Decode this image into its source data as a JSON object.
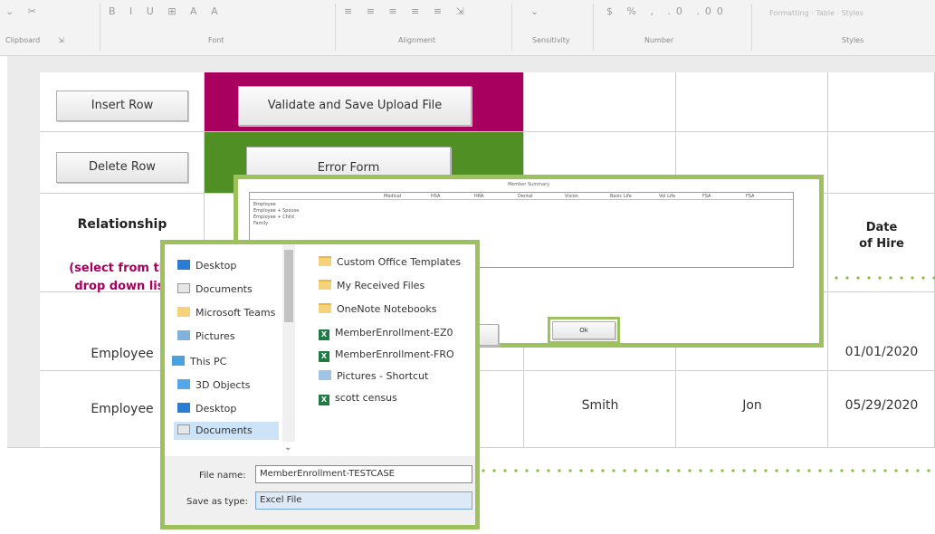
{
  "ribbon": {
    "groups": [
      "Clipboard",
      "Font",
      "Alignment",
      "Sensitivity",
      "Number",
      "Styles"
    ],
    "styles_items": [
      "Formatting",
      "Table",
      "Styles"
    ]
  },
  "sheet": {
    "buttons": {
      "insert_row": "Insert Row",
      "delete_row": "Delete Row",
      "validate_save": "Validate and Save Upload File",
      "error_form": "Error Form"
    },
    "headers": {
      "relationship": "Relationship",
      "relationship_hint_line1": "(select from the",
      "relationship_hint_line2": "drop down list",
      "date_of_hire_line1": "Date",
      "date_of_hire_line2": "of Hire"
    },
    "rows": [
      {
        "relationship": "Employee",
        "last": "",
        "first": "",
        "date": "01/01/2020"
      },
      {
        "relationship": "Employee",
        "last": "Smith",
        "first": "Jon",
        "date": "05/29/2020"
      }
    ]
  },
  "summary_dialog": {
    "title": "Member Summary",
    "columns": [
      "Medical",
      "HSA",
      "HRA",
      "Dental",
      "Vision",
      "Basic Life",
      "Vol Life",
      "FSA",
      "FSA"
    ],
    "rows": [
      "Employee",
      "Employee + Spouse",
      "Employee + Child",
      "Family"
    ],
    "ok_label": "Ok"
  },
  "file_dialog": {
    "nav": [
      "Desktop",
      "Documents",
      "Microsoft Teams",
      "Pictures",
      "This PC",
      "3D Objects",
      "Desktop",
      "Documents"
    ],
    "files": [
      "Custom Office Templates",
      "My Received Files",
      "OneNote Notebooks",
      "MemberEnrollment-EZ0",
      "MemberEnrollment-FRO",
      "Pictures - Shortcut",
      "scott census"
    ],
    "file_name_label": "File name:",
    "file_name_value": "MemberEnrollment-TESTCASE",
    "save_as_label": "Save as type:",
    "save_as_value": "Excel File"
  },
  "colors": {
    "magenta": "#a8005e",
    "green_cell": "#4f8f24",
    "frame_green": "#9dc25d",
    "dots": "#8cbf3f"
  }
}
